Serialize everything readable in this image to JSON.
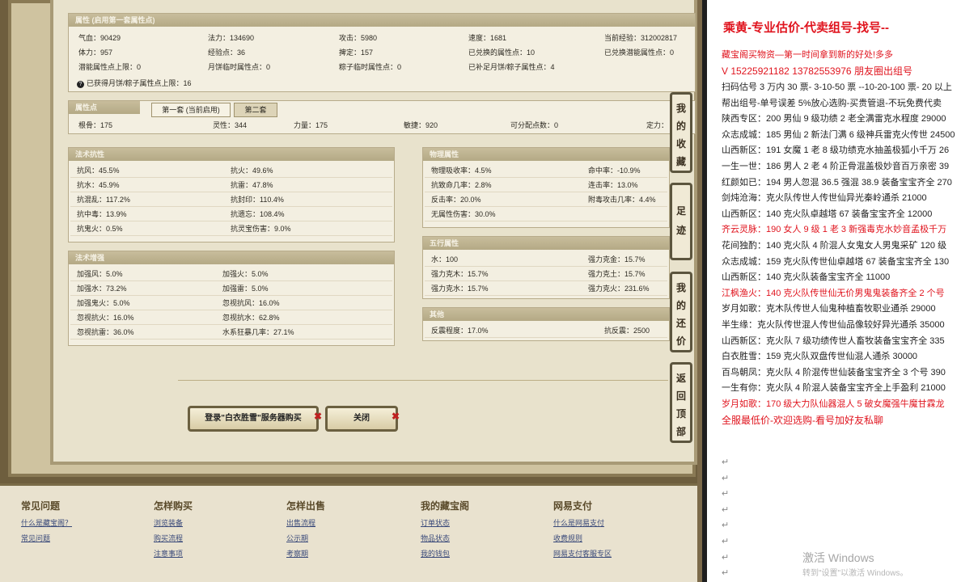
{
  "attr_panel": {
    "title": "属性 (启用第一套属性点)",
    "rows": [
      [
        "气血：90429",
        "法力：134690",
        "攻击：5980",
        "速度：1681",
        "当前经验：312002817"
      ],
      [
        "体力：957",
        "经验点：36",
        "捭定：157",
        "已兑换的属性点：10",
        "已兑换潜能属性点：0"
      ],
      [
        "潜能属性点上限：0",
        "月饼临时属性点：0",
        "粽子临时属性点：0",
        "已补足月饼/粽子属性点：4",
        ""
      ]
    ],
    "note": "已获得月饼/粽子属性点上限：16"
  },
  "points_panel": {
    "title": "属性点",
    "tab1": "第一套 (当前启用)",
    "tab2": "第二套",
    "values": [
      "根骨：175",
      "灵性：344",
      "力量：175",
      "敏捷：920",
      "可分配点数：0",
      "定力："
    ]
  },
  "fa_kang": {
    "title": "法术抗性",
    "rows": [
      [
        "抗风：45.5%",
        "抗火：49.6%"
      ],
      [
        "抗水：45.9%",
        "抗雷：47.8%"
      ],
      [
        "抗混乱：117.2%",
        "抗封印：110.4%"
      ],
      [
        "抗中毒：13.9%",
        "抗遗忘：108.4%"
      ],
      [
        "抗鬼火：0.5%",
        "抗灵宝伤害：9.0%"
      ]
    ]
  },
  "fa_qiang": {
    "title": "法术增强",
    "rows": [
      [
        "加强风：5.0%",
        "加强火：5.0%"
      ],
      [
        "加强水：73.2%",
        "加强雷：5.0%"
      ],
      [
        "加强鬼火：5.0%",
        "忽视抗风：16.0%"
      ],
      [
        "忽视抗火：16.0%",
        "忽视抗水：62.8%"
      ],
      [
        "忽视抗雷：36.0%",
        "水系狂暴几率：27.1%"
      ]
    ]
  },
  "wuli": {
    "title": "物理属性",
    "rows": [
      [
        "物理吸收率：4.5%",
        "命中率：-10.9%"
      ],
      [
        "抗致命几率：2.8%",
        "连击率：13.0%"
      ],
      [
        "反击率：20.0%",
        "附毒攻击几率：4.4%"
      ],
      [
        "无属性伤害：30.0%",
        ""
      ]
    ]
  },
  "wuxing": {
    "title": "五行属性",
    "rows": [
      [
        "水：100",
        "强力克金：15.7%"
      ],
      [
        "强力克木：15.7%",
        "强力克土：15.7%"
      ],
      [
        "强力克水：15.7%",
        "强力克火：231.6%"
      ]
    ]
  },
  "qita": {
    "title": "其他",
    "rows": [
      [
        "反震程度：17.0%",
        "抗反震：2500"
      ]
    ]
  },
  "buttons": {
    "login": "登录\"白衣胜雪\"服务器购买",
    "close": "关闭"
  },
  "side": {
    "collect": "我的收藏",
    "footprint": "足迹",
    "bargain": "我的还价",
    "top": "返回顶部"
  },
  "footer": {
    "cols": [
      {
        "title": "常见问题",
        "links": [
          "什么是藏宝阁？",
          "常见问题"
        ]
      },
      {
        "title": "怎样购买",
        "links": [
          "浏览装备",
          "购买流程",
          "注意事项"
        ]
      },
      {
        "title": "怎样出售",
        "links": [
          "出售流程",
          "公示期",
          "考察期"
        ]
      },
      {
        "title": "我的藏宝阁",
        "links": [
          "订单状态",
          "物品状态",
          "我的钱包"
        ]
      },
      {
        "title": "网易支付",
        "links": [
          "什么是网易支付",
          "收费规则",
          "网易支付客服专区"
        ]
      }
    ]
  },
  "doc": {
    "head": "乘黄-专业估价-代卖组号-找号--",
    "l2": "藏宝阁买物资—第一时间拿到新的好处!多多",
    "l3": "V 15225921182   13782553976 朋友圈出组号",
    "lines": [
      {
        "t": "扫码估号 3 万内 30 票- 3-10-50 票  --10-20-100 票- 20 以上",
        "r": false
      },
      {
        "t": "帮出组号-单号误差 5%放心选购-买贵管退-不玩免费代卖",
        "r": false
      },
      {
        "t": "陕西专区：200 男仙 9 级功绩 2 老全满雷克水程度 29000",
        "r": false
      },
      {
        "t": "众志成城：185 男仙 2 新法门满 6 级神兵雷克火传世 24500",
        "r": false
      },
      {
        "t": "山西新区：191 女魔 1 老 8 级功绩克水抽盖极狐小千万 26",
        "r": false
      },
      {
        "t": "一生一世：186 男人 2 老 4 阶正骨混盖极妙音百万亲密 39",
        "r": false
      },
      {
        "t": "红颜如已：194 男人忽混 36.5 强混 38.9 装备宝宝齐全 270",
        "r": false
      },
      {
        "t": "剑炖沧海：克火队传世人传世仙异光秦岭通杀 21000",
        "r": false
      },
      {
        "t": "山西新区：140 克火队卓越塔 67 装备宝宝齐全 12000",
        "r": false
      },
      {
        "t": "齐云灵脉：190 女人 9 级 1 老 3 新强毒克水妙音孟极千万",
        "r": true
      },
      {
        "t": "花间独酌：140 克火队 4 阶混人女鬼女人男鬼采矿 120 级",
        "r": false
      },
      {
        "t": "众志成城：159 克火队传世仙卓越塔 67 装备宝宝齐全 130",
        "r": false
      },
      {
        "t": "山西新区：140 克火队装备宝宝齐全 11000",
        "r": false
      },
      {
        "t": "江枫渔火：140 克火队传世仙无价男鬼鬼装备齐全 2 个号",
        "r": true
      },
      {
        "t": "岁月如歌：克木队传世人仙鬼种植畜牧职业通杀 29000",
        "r": false
      },
      {
        "t": "半生缘：克火队传世混人传世仙品像较好异光通杀 35000",
        "r": false
      },
      {
        "t": "山西新区：克火队 7 级功绩传世人畜牧装备宝宝齐全 335",
        "r": false
      },
      {
        "t": "白衣胜雪：159 克火队双盘传世仙混人通杀 30000",
        "r": false
      },
      {
        "t": "百鸟朝凤：克火队 4 阶混传世仙装备宝宝齐全 3 个号 390",
        "r": false
      },
      {
        "t": "一生有你：克火队 4 阶混人装备宝宝齐全上手盈利 21000",
        "r": false
      },
      {
        "t": "岁月如歌：170 级大力队仙器混人 5 破女魔强牛魔甘霖龙",
        "r": true
      },
      {
        "t": "全服最低价-欢迎选购-看号加好友私聊",
        "r": true
      }
    ],
    "watermark1": "激活 Windows",
    "watermark2": "转到\"设置\"以激活 Windows。"
  }
}
